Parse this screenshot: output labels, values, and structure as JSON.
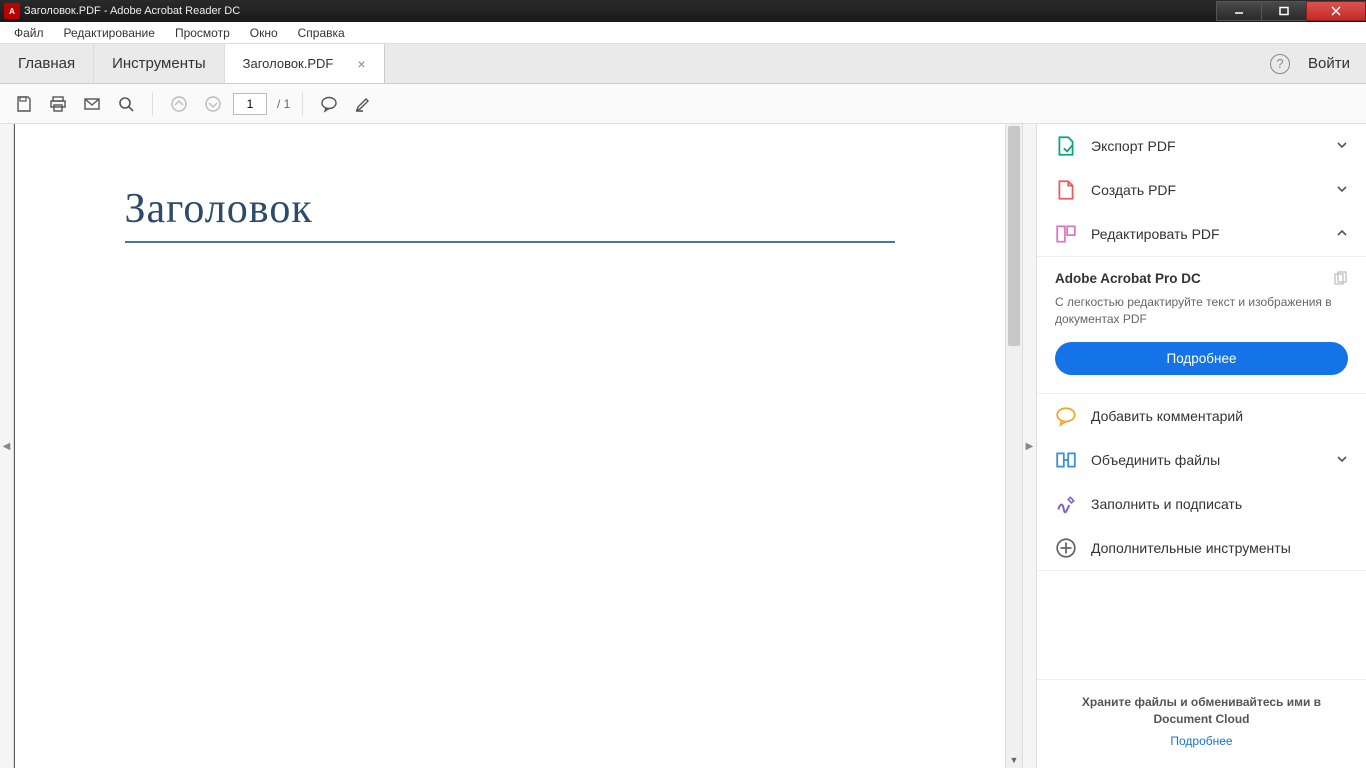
{
  "titlebar": {
    "title": "Заголовок.PDF - Adobe Acrobat Reader DC"
  },
  "menubar": {
    "items": [
      "Файл",
      "Редактирование",
      "Просмотр",
      "Окно",
      "Справка"
    ]
  },
  "tabs": {
    "home": "Главная",
    "tools": "Инструменты",
    "doc": "Заголовок.PDF",
    "help_glyph": "?",
    "signin": "Войти"
  },
  "toolbar": {
    "page_current": "1",
    "page_total": "/ 1"
  },
  "document": {
    "heading": "Заголовок"
  },
  "rightpanel": {
    "export": "Экспорт PDF",
    "create": "Создать PDF",
    "edit": "Редактировать PDF",
    "promo_title": "Adobe Acrobat Pro DC",
    "promo_text": "С легкостью редактируйте текст и изображения в документах PDF",
    "promo_button": "Подробнее",
    "comment": "Добавить комментарий",
    "combine": "Объединить файлы",
    "fillsign": "Заполнить и подписать",
    "moretools": "Дополнительные инструменты",
    "footer_text": "Храните файлы и обменивайтесь ими в Document Cloud",
    "footer_link": "Подробнее"
  }
}
